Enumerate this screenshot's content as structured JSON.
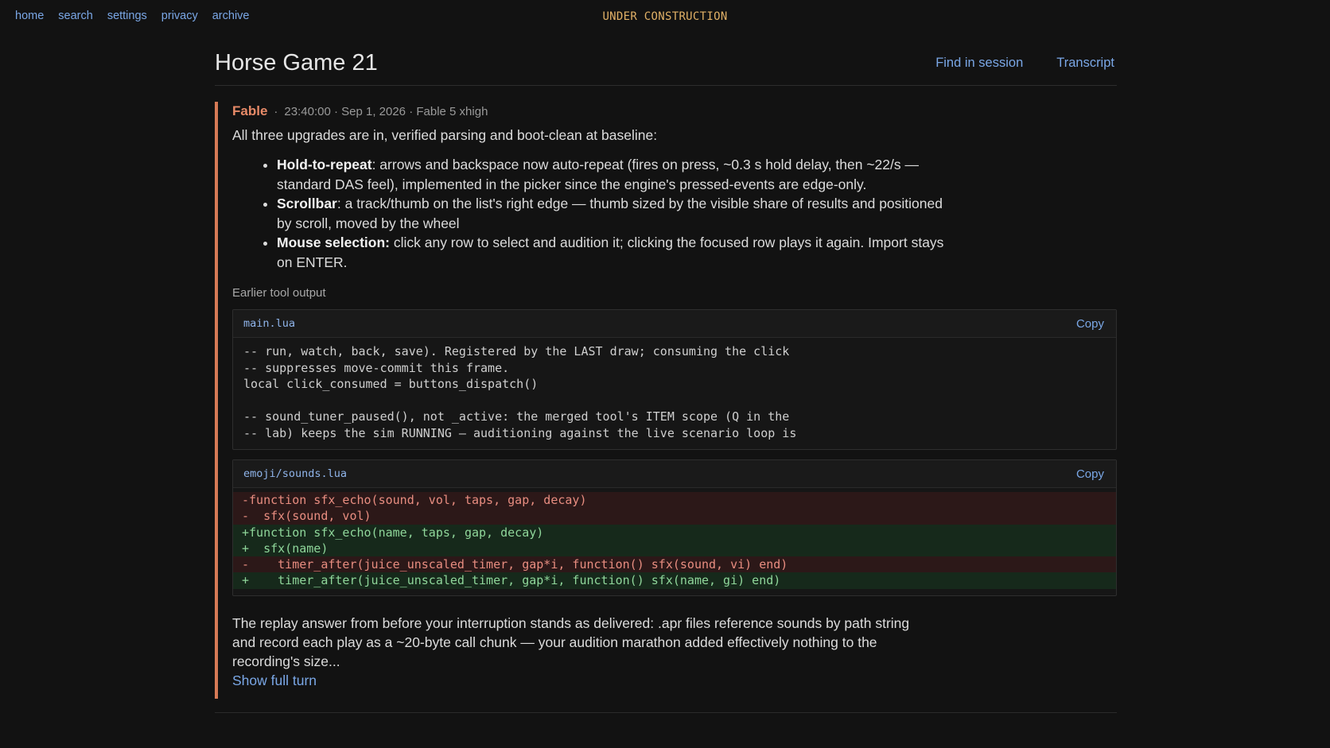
{
  "nav": {
    "items": [
      "home",
      "search",
      "settings",
      "privacy",
      "archive"
    ]
  },
  "banner": "UNDER CONSTRUCTION",
  "header": {
    "title": "Horse Game 21",
    "find_label": "Find in session",
    "transcript_label": "Transcript"
  },
  "turn": {
    "speaker": "Fable",
    "separator": "·",
    "meta": "23:40:00 · Sep 1, 2026 · Fable 5 xhigh",
    "intro": "All three upgrades are in, verified parsing and boot-clean at baseline:",
    "bullets": [
      {
        "title": "Hold-to-repeat",
        "text": ": arrows and backspace now auto-repeat (fires on press, ~0.3 s hold delay, then ~22/s — standard DAS feel), implemented in the picker since the engine's pressed-events are edge-only."
      },
      {
        "title": "Scrollbar",
        "text": ": a track/thumb on the list's right edge — thumb sized by the visible share of results and positioned by scroll, moved by the wheel"
      },
      {
        "title": "Mouse selection:",
        "text": " click any row to select and audition it; clicking the focused row plays it again. Import stays on ENTER."
      }
    ],
    "earlier_label": "Earlier tool output",
    "code_blocks": [
      {
        "filename": "main.lua",
        "copy_label": "Copy",
        "code": "-- run, watch, back, save). Registered by the LAST draw; consuming the click\n-- suppresses move-commit this frame.\nlocal click_consumed = buttons_dispatch()\n\n-- sound_tuner_paused(), not _active: the merged tool's ITEM scope (Q in the\n-- lab) keeps the sim RUNNING — auditioning against the live scenario loop is"
      },
      {
        "filename": "emoji/sounds.lua",
        "copy_label": "Copy",
        "diff": [
          {
            "kind": "del",
            "text": "-function sfx_echo(sound, vol, taps, gap, decay)"
          },
          {
            "kind": "del",
            "text": "-  sfx(sound, vol)"
          },
          {
            "kind": "add",
            "text": "+function sfx_echo(name, taps, gap, decay)"
          },
          {
            "kind": "add",
            "text": "+  sfx(name)"
          },
          {
            "kind": "del",
            "text": "-    timer_after(juice_unscaled_timer, gap*i, function() sfx(sound, vi) end)"
          },
          {
            "kind": "add",
            "text": "+    timer_after(juice_unscaled_timer, gap*i, function() sfx(name, gi) end)"
          }
        ]
      }
    ],
    "outro": "The replay answer from before your interruption stands as delivered: .apr files reference sounds by path string and record each play as a ~20-byte call chunk — your audition marathon added effectively nothing to the recording's size...",
    "show_full_label": "Show full turn"
  },
  "colors": {
    "background": "#121212",
    "link": "#7aa7e6",
    "accent_border": "#d67a56",
    "speaker": "#e78a68",
    "banner": "#e0b066",
    "diff_del_bg": "#2c1818",
    "diff_add_bg": "#16291b"
  }
}
